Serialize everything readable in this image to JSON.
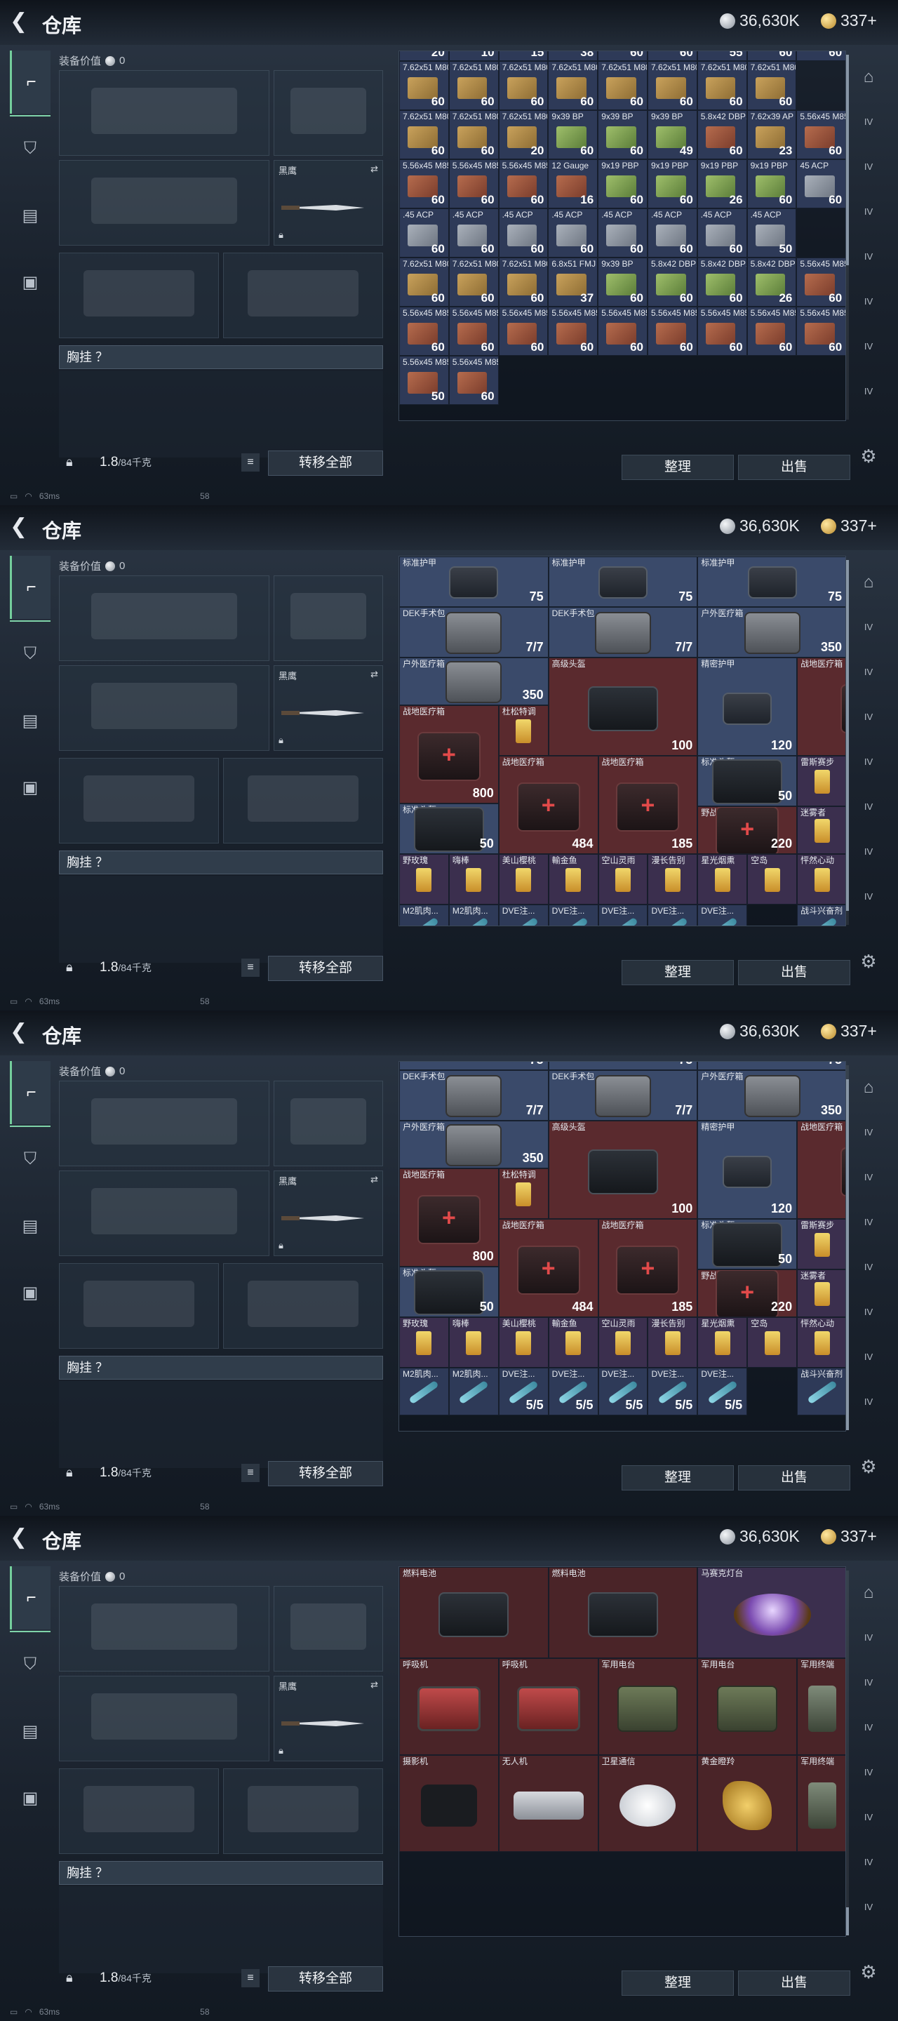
{
  "header": {
    "title": "仓库",
    "silver": "36,630K",
    "gold": "337+"
  },
  "equipment": {
    "value_label": "装备价值",
    "value": "0",
    "knife_name": "黑鹰",
    "chest_rig": "胸挂 ？",
    "weight": "1.8",
    "weight_max": "/84千克",
    "transfer_all": "转移全部"
  },
  "actions": {
    "sort": "整理",
    "sell": "出售"
  },
  "status": {
    "ping": "63ms",
    "fps": "58"
  },
  "icons": {
    "back": "back-arrow-icon",
    "weapon": "pistol-icon",
    "armor": "vest-icon",
    "backpack": "backpack-icon",
    "case": "briefcase-icon",
    "lock": "lock-icon",
    "list": "list-icon",
    "settings": "gear-icon",
    "silver": "silver-coin-icon",
    "gold": "gold-coin-icon"
  },
  "screens": [
    {
      "kind": "ammo",
      "top_row": [
        "20",
        "10",
        "15",
        "38",
        "60",
        "60",
        "55",
        "60",
        "60"
      ],
      "rows": [
        [
          {
            "n": "7.62x51 M80",
            "q": "60",
            "c": "tan"
          },
          {
            "n": "7.62x51 M80",
            "q": "60",
            "c": "tan"
          },
          {
            "n": "7.62x51 M80",
            "q": "60",
            "c": "tan"
          },
          {
            "n": "7.62x51 M80",
            "q": "60",
            "c": "tan"
          },
          {
            "n": "7.62x51 M80",
            "q": "60",
            "c": "tan"
          },
          {
            "n": "7.62x51 M80",
            "q": "60",
            "c": "tan"
          },
          {
            "n": "7.62x51 M80",
            "q": "60",
            "c": "tan"
          },
          {
            "n": "7.62x51 M80",
            "q": "60",
            "c": "tan"
          }
        ],
        [
          {
            "n": "7.62x51 M80",
            "q": "60",
            "c": "tan"
          },
          {
            "n": "7.62x51 M80",
            "q": "60",
            "c": "tan"
          },
          {
            "n": "7.62x51 M80",
            "q": "20",
            "c": "tan"
          },
          {
            "n": "9x39 BP",
            "q": "60",
            "c": "grn"
          },
          {
            "n": "9x39 BP",
            "q": "60",
            "c": "grn"
          },
          {
            "n": "9x39 BP",
            "q": "49",
            "c": "grn"
          },
          {
            "n": "5.8x42 DBP10",
            "q": "60",
            "c": "red"
          },
          {
            "n": "7.62x39 AP",
            "q": "23",
            "c": "tan"
          },
          {
            "n": "5.56x45 M855",
            "q": "60",
            "c": "red"
          }
        ],
        [
          {
            "n": "5.56x45 M855",
            "q": "60",
            "c": "red"
          },
          {
            "n": "5.56x45 M855",
            "q": "60",
            "c": "red"
          },
          {
            "n": "5.56x45 M855",
            "q": "60",
            "c": "red"
          },
          {
            "n": "12 Gauge",
            "q": "16",
            "c": "red"
          },
          {
            "n": "9x19 PBP",
            "q": "60",
            "c": "grn"
          },
          {
            "n": "9x19 PBP",
            "q": "60",
            "c": "grn"
          },
          {
            "n": "9x19 PBP",
            "q": "26",
            "c": "grn"
          },
          {
            "n": "9x19 PBP",
            "q": "60",
            "c": "grn"
          },
          {
            "n": "45 ACP",
            "q": "60",
            "c": "gry"
          }
        ],
        [
          {
            "n": ".45 ACP",
            "q": "60",
            "c": "gry"
          },
          {
            "n": ".45 ACP",
            "q": "60",
            "c": "gry"
          },
          {
            "n": ".45 ACP",
            "q": "60",
            "c": "gry"
          },
          {
            "n": ".45 ACP",
            "q": "60",
            "c": "gry"
          },
          {
            "n": ".45 ACP",
            "q": "60",
            "c": "gry"
          },
          {
            "n": ".45 ACP",
            "q": "60",
            "c": "gry"
          },
          {
            "n": ".45 ACP",
            "q": "60",
            "c": "gry"
          },
          {
            "n": ".45 ACP",
            "q": "50",
            "c": "gry"
          }
        ],
        [
          {
            "n": "7.62x51 M80",
            "q": "60",
            "c": "tan"
          },
          {
            "n": "7.62x51 M80",
            "q": "60",
            "c": "tan"
          },
          {
            "n": "7.62x51 M80",
            "q": "60",
            "c": "tan"
          },
          {
            "n": "6.8x51 FMJ",
            "q": "37",
            "c": "tan"
          },
          {
            "n": "9x39 BP",
            "q": "60",
            "c": "grn"
          },
          {
            "n": "5.8x42 DBP10",
            "q": "60",
            "c": "grn"
          },
          {
            "n": "5.8x42 DBP10",
            "q": "60",
            "c": "grn"
          },
          {
            "n": "5.8x42 DBP10",
            "q": "26",
            "c": "grn"
          },
          {
            "n": "5.56x45 M855A1",
            "q": "60",
            "c": "red"
          }
        ],
        [
          {
            "n": "5.56x45 M855A1",
            "q": "60",
            "c": "red"
          },
          {
            "n": "5.56x45 M855A1",
            "q": "60",
            "c": "red"
          },
          {
            "n": "5.56x45 M855A1",
            "q": "60",
            "c": "red"
          },
          {
            "n": "5.56x45 M855A1",
            "q": "60",
            "c": "red"
          },
          {
            "n": "5.56x45 M855A1",
            "q": "60",
            "c": "red"
          },
          {
            "n": "5.56x45 M855A1",
            "q": "60",
            "c": "red"
          },
          {
            "n": "5.56x45 M855A1",
            "q": "60",
            "c": "red"
          },
          {
            "n": "5.56x45 M855A1",
            "q": "60",
            "c": "red"
          },
          {
            "n": "5.56x45 M855A1",
            "q": "60",
            "c": "red"
          }
        ],
        [
          {
            "n": "5.56x45 M855A1",
            "q": "50",
            "c": "red"
          },
          {
            "n": "5.56x45 M855A1",
            "q": "60",
            "c": "red"
          }
        ]
      ]
    },
    {
      "kind": "gear1"
    },
    {
      "kind": "gear2"
    },
    {
      "kind": "loot"
    }
  ],
  "gear": {
    "vest": "标准护甲",
    "vest_dur": "75",
    "dek": "DEK手术包",
    "dek_q": "7/7",
    "outdoor": "户外医疗箱",
    "outdoor_q": "350",
    "helmet": "高级头盔",
    "helmet_dur": "100",
    "fine_armor": "精密护甲",
    "fine_dur": "120",
    "field_kit": "战地医疗箱",
    "field_q": "800",
    "field_q2": "484",
    "field_q3": "185",
    "du": "杜松特调",
    "std_helm": "标准头盔",
    "std_helm_dur": "50",
    "wild_kit": "野战急救包",
    "wild_q": "220",
    "thunder": "雷斯赛步",
    "misty": "迷雾者",
    "std_helm2": "标准头盔",
    "drinks": [
      "野玫瑰",
      "嗨棒",
      "美山樱桃",
      "輸金鱼",
      "空山灵雨",
      "漫长告别",
      "星光烟熏",
      "空岛",
      "怦然心动"
    ],
    "syringes": [
      "M2肌肉...",
      "M2肌肉...",
      "DVE注...",
      "DVE注...",
      "DVE注...",
      "DVE注...",
      "DVE注...",
      "战斗兴奋剂"
    ],
    "dve_q": "5/5"
  },
  "loot": {
    "row1": [
      "燃料电池",
      "燃料电池",
      "马赛克灯台"
    ],
    "row2": [
      "呼吸机",
      "呼吸机",
      "军用电台",
      "军用电台",
      "军用终端"
    ],
    "row3": [
      "摄影机",
      "无人机",
      "卫星通信",
      "黄金瞪羚",
      "军用终端"
    ]
  }
}
